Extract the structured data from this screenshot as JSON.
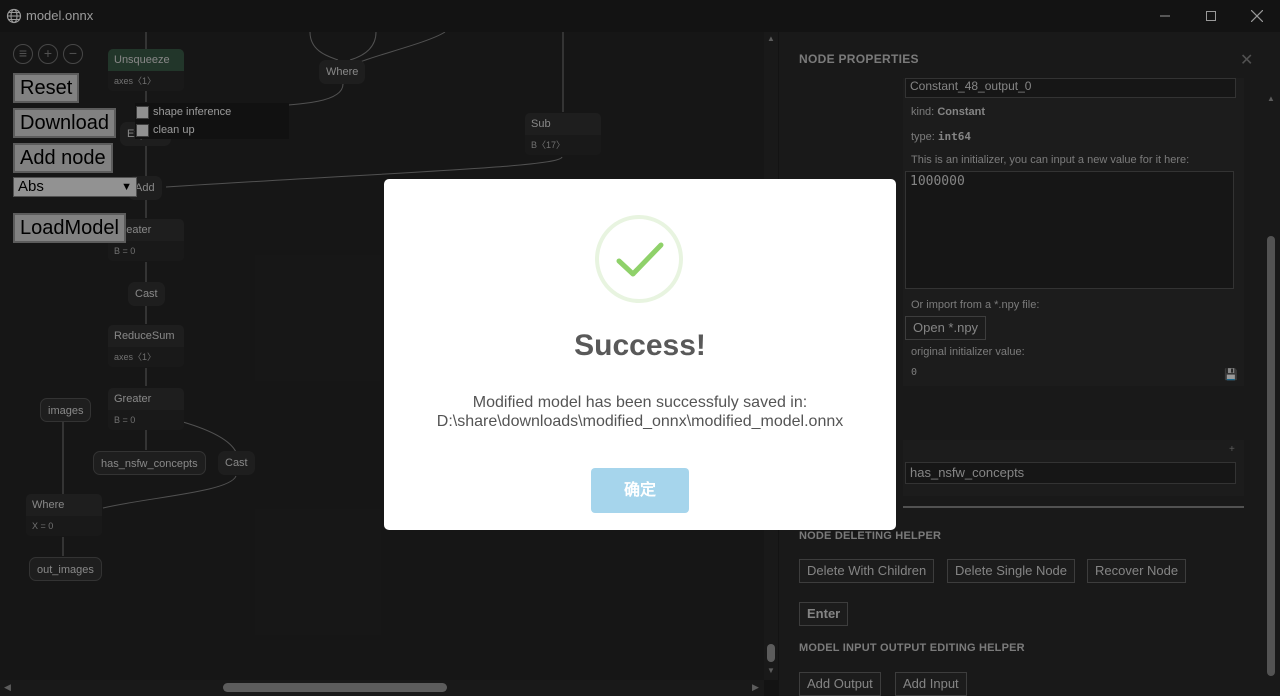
{
  "window": {
    "title": "model.onnx"
  },
  "toolbar": {
    "reset_label": "Reset",
    "download_label": "Download",
    "add_node_label": "Add node",
    "op_selected": "Abs",
    "load_model_label": "LoadModel",
    "shape_inference_label": "shape inference",
    "clean_up_label": "clean up"
  },
  "graph": {
    "nodes": {
      "unsqueeze": {
        "op": "Unsqueeze",
        "attr": "axes〈1〉"
      },
      "where_top": {
        "op": "Where"
      },
      "sub": {
        "op": "Sub",
        "attr": "B〈17〉"
      },
      "expand": {
        "op": "Expand"
      },
      "add": {
        "op": "Add"
      },
      "greater1": {
        "op": "Greater",
        "attr": "B = 0"
      },
      "cast1": {
        "op": "Cast"
      },
      "reducesum": {
        "op": "ReduceSum",
        "attr": "axes〈1〉"
      },
      "greater2": {
        "op": "Greater",
        "attr": "B = 0"
      },
      "images": {
        "label": "images"
      },
      "has_nsfw": {
        "label": "has_nsfw_concepts"
      },
      "cast2": {
        "op": "Cast"
      },
      "where_bottom": {
        "op": "Where",
        "attr": "X = 0"
      },
      "out_images": {
        "label": "out_images"
      }
    }
  },
  "panel": {
    "title": "NODE PROPERTIES",
    "partial_name": "Constant_48_output_0",
    "kind_label": "kind:",
    "kind_value": "Constant",
    "type_label": "type:",
    "type_value": "int64",
    "initializer_hint": "This is an initializer, you can input a new value for it here:",
    "initializer_value": "1000000",
    "import_hint": "Or import from a *.npy file:",
    "open_npy_label": "Open *.npy",
    "original_label": "original initializer value:",
    "original_value": "0",
    "plus": "+",
    "output_name": "has_nsfw_concepts",
    "deleting_helper_title": "NODE DELETING HELPER",
    "delete_with_children_label": "Delete With Children",
    "delete_single_label": "Delete Single Node",
    "recover_label": "Recover Node",
    "enter_label": "Enter",
    "io_helper_title": "MODEL INPUT OUTPUT EDITING HELPER",
    "add_output_label": "Add Output",
    "add_input_label": "Add Input"
  },
  "modal": {
    "title": "Success!",
    "message_line1": "Modified model has been successfuly saved in:",
    "message_line2": "D:\\share\\downloads\\modified_onnx\\modified_model.onnx",
    "ok_label": "确定"
  },
  "colors": {
    "success_green": "#8fd16a",
    "confirm_button": "#a6d5ec"
  }
}
